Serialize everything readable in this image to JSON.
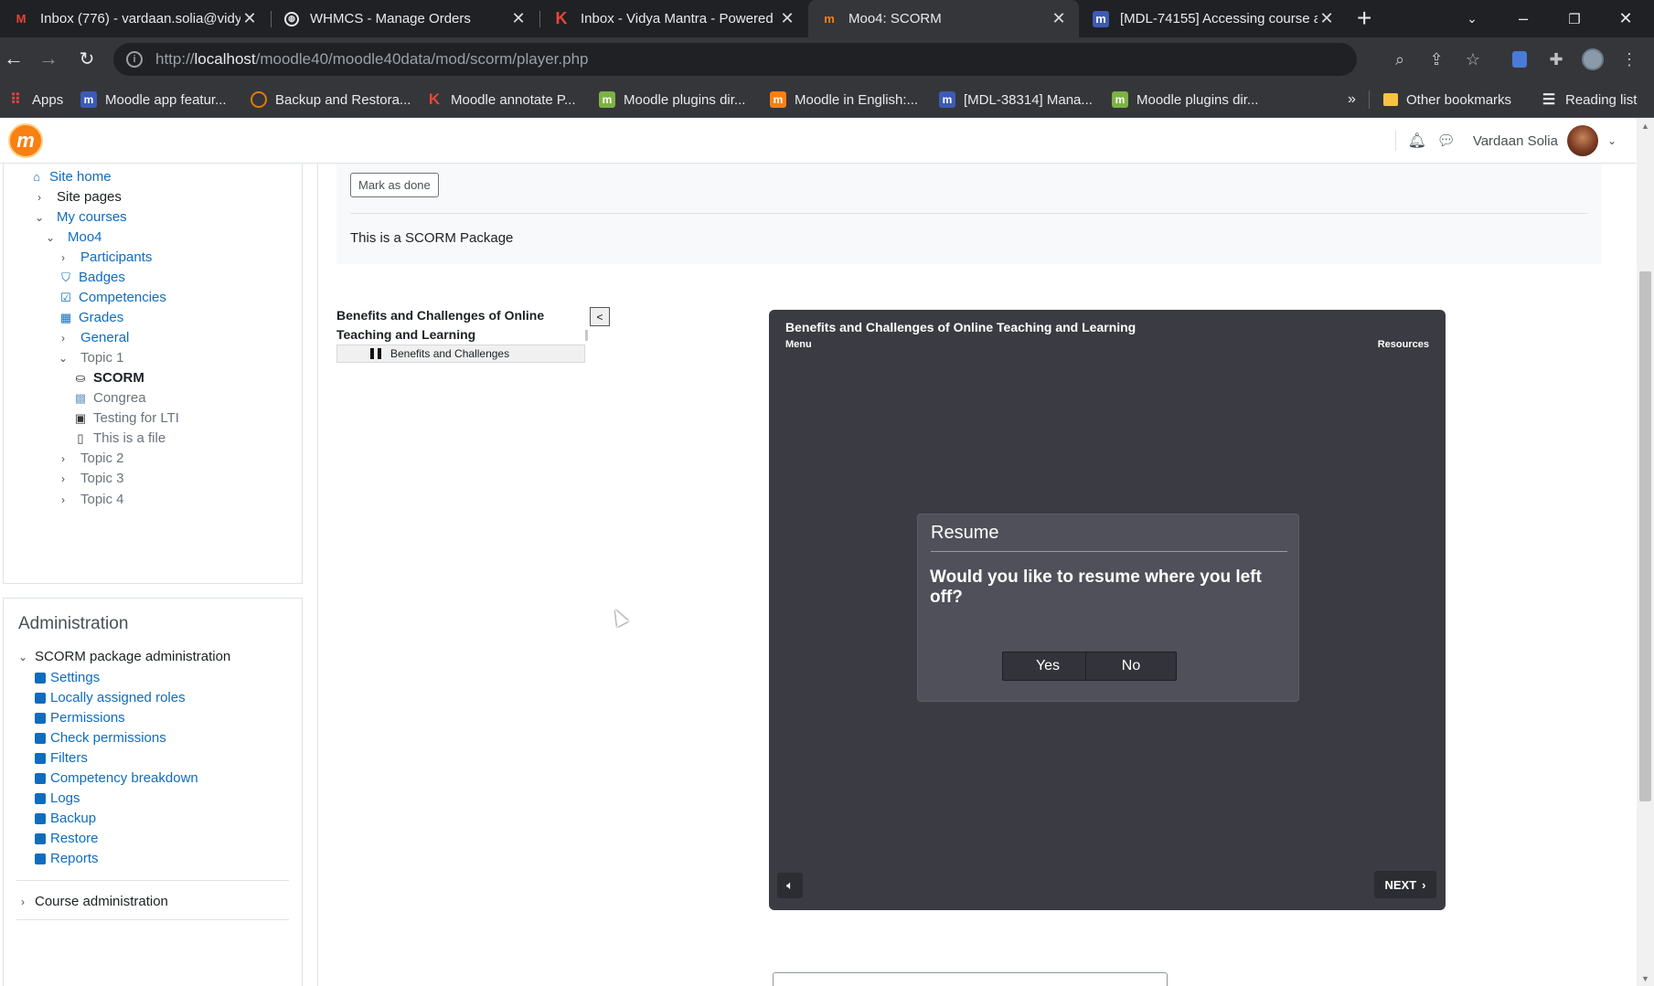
{
  "browser": {
    "tabs": [
      {
        "title": "Inbox (776) - vardaan.solia@vidy",
        "icon": "gmail-icon"
      },
      {
        "title": "WHMCS - Manage Orders",
        "icon": "globe-icon"
      },
      {
        "title": "Inbox - Vidya Mantra - Powered",
        "icon": "k-icon"
      },
      {
        "title": "Moo4: SCORM",
        "icon": "moodle-icon"
      },
      {
        "title": "[MDL-74155] Accessing course a",
        "icon": "moodle-tracker-icon"
      }
    ],
    "url_prefix": "http://",
    "url_host": "localhost",
    "url_path": "/moodle40/moodle40data/mod/scorm/player.php",
    "bookmarks": [
      "Apps",
      "Moodle app featur...",
      "Backup and Restora...",
      "Moodle annotate P...",
      "Moodle plugins dir...",
      "Moodle in English:...",
      "[MDL-38314] Mana...",
      "Moodle plugins dir..."
    ],
    "more_bookmarks": "»",
    "other_bookmarks": "Other bookmarks",
    "reading_list": "Reading list"
  },
  "navbar": {
    "user_name": "Vardaan Solia"
  },
  "nav_tree": [
    {
      "label": "Site home"
    },
    {
      "label": "Site pages"
    },
    {
      "label": "My courses"
    },
    {
      "label": "Moo4"
    },
    {
      "label": "Participants"
    },
    {
      "label": "Badges"
    },
    {
      "label": "Competencies"
    },
    {
      "label": "Grades"
    },
    {
      "label": "General"
    },
    {
      "label": "Topic 1"
    },
    {
      "label": "SCORM"
    },
    {
      "label": "Congrea"
    },
    {
      "label": "Testing for LTI"
    },
    {
      "label": "This is a file"
    },
    {
      "label": "Topic 2"
    },
    {
      "label": "Topic 3"
    },
    {
      "label": "Topic 4"
    }
  ],
  "administration": {
    "title": "Administration",
    "section": "SCORM package administration",
    "items": [
      "Settings",
      "Locally assigned roles",
      "Permissions",
      "Check permissions",
      "Filters",
      "Competency breakdown",
      "Logs",
      "Backup",
      "Restore",
      "Reports"
    ],
    "course_admin": "Course administration"
  },
  "activity": {
    "mark_done": "Mark as done",
    "description": "This is a SCORM Package"
  },
  "toc": {
    "title": "Benefits and Challenges of Online Teaching and Learning",
    "item": "Benefits and Challenges",
    "collapse": "<"
  },
  "player": {
    "title": "Benefits and Challenges of Online Teaching and Learning",
    "menu": "Menu",
    "resources": "Resources",
    "dialog": {
      "title": "Resume",
      "message": "Would you like to resume where you left off?",
      "yes": "Yes",
      "no": "No"
    },
    "next": "NEXT"
  }
}
